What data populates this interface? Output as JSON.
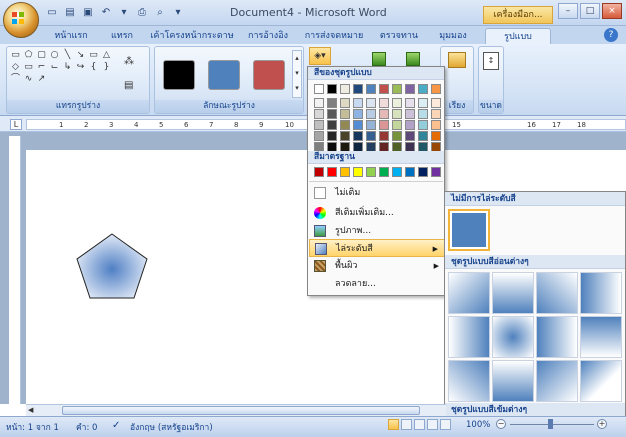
{
  "window": {
    "title": "Document4 - Microsoft Word",
    "contextual_tab_title": "เครื่องมือก...",
    "buttons": [
      "–",
      "□",
      "×"
    ]
  },
  "quick_access": [
    "new-icon",
    "open-icon",
    "save-icon",
    "undo-icon",
    "redo-icon",
    "print-icon",
    "preview-icon",
    "dropdown-icon"
  ],
  "tabs": [
    {
      "label": "หน้าแรก"
    },
    {
      "label": "แทรก"
    },
    {
      "label": "เค้าโครงหน้ากระดาษ"
    },
    {
      "label": "การอ้างอิง"
    },
    {
      "label": "การส่งจดหมาย"
    },
    {
      "label": "ตรวจทาน"
    },
    {
      "label": "มุมมอง"
    },
    {
      "label": "รูปแบบ",
      "active": true
    }
  ],
  "ribbon": {
    "groups": [
      {
        "label": "แทรกรูปร่าง"
      },
      {
        "label": "ลักษณะรูปร่าง"
      },
      {
        "label": "เรียง"
      },
      {
        "label": "ขนาด"
      }
    ],
    "shape_style_colors": [
      "#000000",
      "#4f81bd",
      "#c0504d"
    ]
  },
  "ruler": {
    "numbers": [
      "1",
      "2",
      "3",
      "4",
      "5",
      "6",
      "7",
      "8",
      "9",
      "10",
      "11",
      "12",
      "13",
      "14",
      "15",
      "16",
      "17",
      "18"
    ]
  },
  "menu": {
    "theme_colors_header": "สีของชุดรูปแบบ",
    "standard_colors_header": "สีมาตรฐาน",
    "theme_colors_top": [
      "#ffffff",
      "#000000",
      "#eeece1",
      "#1f497d",
      "#4f81bd",
      "#c0504d",
      "#9bbb59",
      "#8064a2",
      "#4bacc6",
      "#f79646"
    ],
    "theme_colors_shades": [
      [
        "#f2f2f2",
        "#7f7f7f",
        "#ddd9c3",
        "#c6d9f0",
        "#dbe5f1",
        "#f2dcdb",
        "#ebf1dd",
        "#e5e0ec",
        "#dbeef3",
        "#fdeada"
      ],
      [
        "#d8d8d8",
        "#595959",
        "#c4bd97",
        "#8db3e2",
        "#b8cce4",
        "#e5b9b7",
        "#d7e3bc",
        "#ccc1d9",
        "#b7dde8",
        "#fbd5b5"
      ],
      [
        "#bfbfbf",
        "#3f3f3f",
        "#938953",
        "#548dd4",
        "#95b3d7",
        "#d99694",
        "#c3d69b",
        "#b2a2c7",
        "#92cddc",
        "#fac08f"
      ],
      [
        "#a5a5a5",
        "#262626",
        "#494429",
        "#17365d",
        "#366092",
        "#953734",
        "#76923c",
        "#5f497a",
        "#31859b",
        "#e36c09"
      ],
      [
        "#7f7f7f",
        "#0c0c0c",
        "#1d1b10",
        "#0f243e",
        "#244061",
        "#632423",
        "#4f6128",
        "#3f3151",
        "#205867",
        "#974806"
      ]
    ],
    "standard_colors": [
      "#c00000",
      "#ff0000",
      "#ffc000",
      "#ffff00",
      "#92d050",
      "#00b050",
      "#00b0f0",
      "#0070c0",
      "#002060",
      "#7030a0"
    ],
    "items": [
      {
        "label": "ไม่เติม",
        "icon": "no-fill-icon"
      },
      {
        "label": "สีเติมเพิ่มเติม...",
        "icon": "more-colors-icon"
      },
      {
        "label": "รูปภาพ...",
        "icon": "picture-icon"
      },
      {
        "label": "ไล่ระดับสี",
        "icon": "gradient-icon",
        "highlighted": true,
        "submenu": true
      },
      {
        "label": "พื้นผิว",
        "icon": "texture-icon",
        "submenu": true
      },
      {
        "label": "ลวดลาย...",
        "icon": "pattern-icon"
      }
    ]
  },
  "submenu": {
    "no_gradient_header": "ไม่มีการไล่ระดับสี",
    "light_variations_header": "ชุดรูปแบบสีอ่อนต่างๆ",
    "dark_variations_header": "ชุดรูปแบบสีเข้มต่างๆ",
    "swatch_color": "#4f81bd"
  },
  "status": {
    "page": "หน้า: 1 จาก 1",
    "words": "คำ: 0",
    "language": "อังกฤษ (สหรัฐอเมริกา)",
    "zoom": "100%"
  }
}
